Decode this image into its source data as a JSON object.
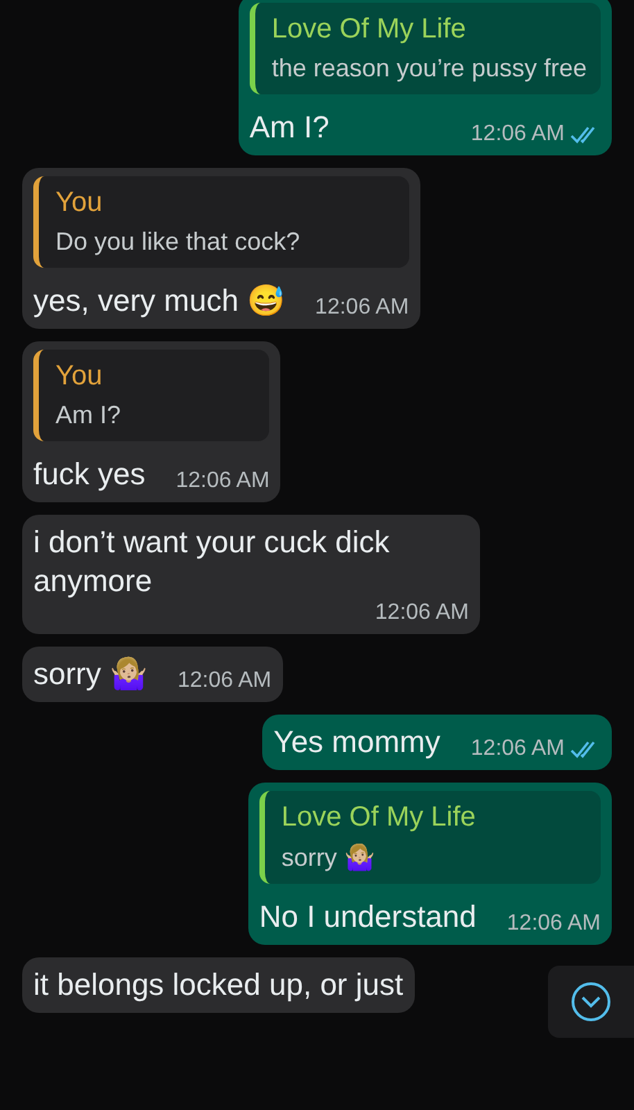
{
  "messages": [
    {
      "kind": "outgoing",
      "quote": {
        "author": "Love Of My Life",
        "text": "the reason you’re pussy free"
      },
      "text": "Am I?",
      "time": "12:06 AM",
      "read": true
    },
    {
      "kind": "incoming",
      "quote": {
        "author": "You",
        "text": "Do you like that cock?"
      },
      "text": "yes, very much 😅",
      "time": "12:06 AM"
    },
    {
      "kind": "incoming",
      "quote": {
        "author": "You",
        "text": "Am I?"
      },
      "text": "fuck yes",
      "time": "12:06 AM"
    },
    {
      "kind": "incoming",
      "text": "i don’t want your cuck dick anymore",
      "time": "12:06 AM"
    },
    {
      "kind": "incoming",
      "text": "sorry 🤷🏼‍♀️",
      "time": "12:06 AM"
    },
    {
      "kind": "outgoing",
      "text": "Yes mommy",
      "time": "12:06 AM",
      "read": true
    },
    {
      "kind": "outgoing",
      "quote": {
        "author": "Love Of My Life",
        "text": "sorry 🤷🏼‍♀️"
      },
      "text": "No I understand",
      "time": "12:06 AM"
    },
    {
      "kind": "incoming",
      "text": "it belongs locked up, or just"
    }
  ]
}
